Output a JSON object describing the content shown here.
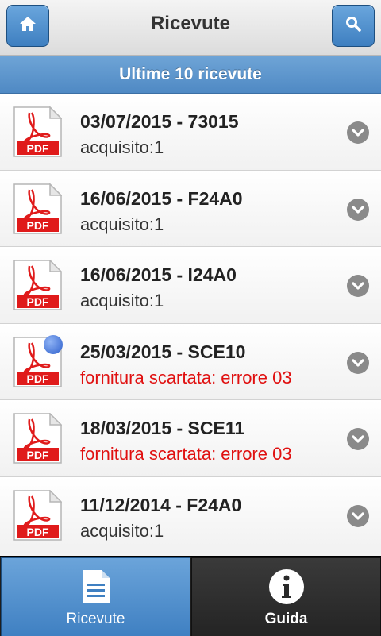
{
  "header": {
    "title": "Ricevute",
    "home_icon": "home-icon",
    "search_icon": "search-icon"
  },
  "banner": {
    "label": "Ultime 10 ricevute"
  },
  "rows": [
    {
      "title": "03/07/2015 - 73015",
      "subtitle": "acquisito:1",
      "status": "ok"
    },
    {
      "title": "16/06/2015 - F24A0",
      "subtitle": "acquisito:1",
      "status": "ok"
    },
    {
      "title": "16/06/2015 - I24A0",
      "subtitle": "acquisito:1",
      "status": "ok"
    },
    {
      "title": "25/03/2015 - SCE10",
      "subtitle": "fornitura scartata: errore 03",
      "status": "error",
      "new": true
    },
    {
      "title": "18/03/2015 - SCE11",
      "subtitle": "fornitura scartata: errore 03",
      "status": "error"
    },
    {
      "title": "11/12/2014 - F24A0",
      "subtitle": "acquisito:1",
      "status": "ok"
    }
  ],
  "pdf_badge": "PDF",
  "tabs": [
    {
      "label": "Ricevute",
      "icon": "document-icon",
      "active": true
    },
    {
      "label": "Guida",
      "icon": "info-icon",
      "active": false
    }
  ],
  "colors": {
    "accent": "#4f89c4",
    "error": "#e01010",
    "pdf_red": "#e01b1b"
  }
}
